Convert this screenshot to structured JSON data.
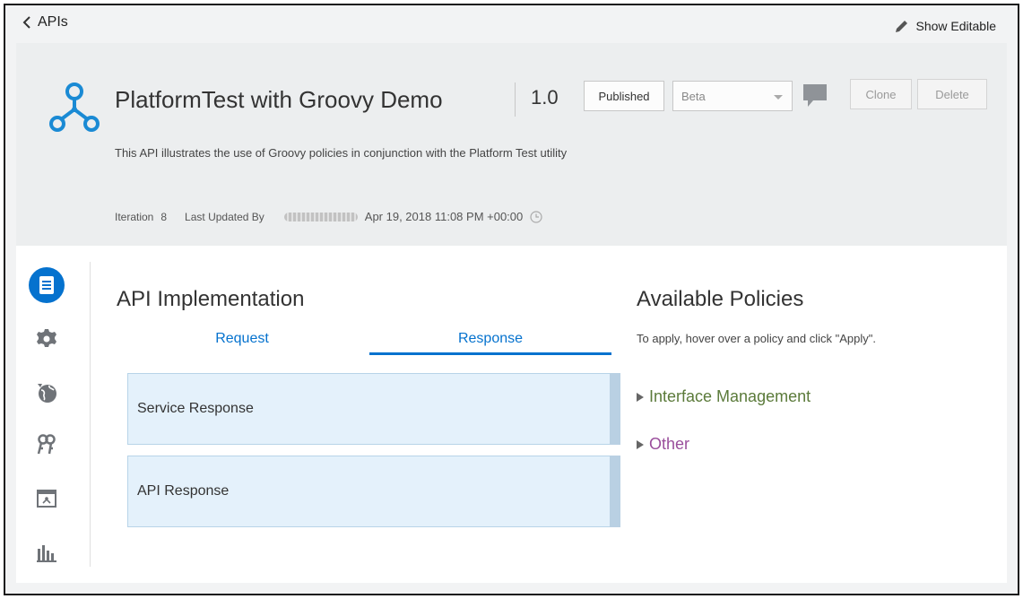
{
  "topbar": {
    "back_label": "APIs",
    "show_editable_label": "Show Editable"
  },
  "header": {
    "title": "PlatformTest with Groovy Demo",
    "version": "1.0",
    "state_button": "Published",
    "stage_select": {
      "selected": "Beta"
    },
    "clone_label": "Clone",
    "delete_label": "Delete",
    "description": "This API illustrates the use of Groovy policies in conjunction with the Platform Test utility",
    "meta": {
      "iteration_label": "Iteration",
      "iteration_value": "8",
      "updated_by_label": "Last Updated By",
      "updated_date": "Apr 19, 2018 11:08 PM +00:00"
    }
  },
  "sidebar": {
    "items": [
      {
        "icon": "implementation-icon",
        "active": true
      },
      {
        "icon": "gear-icon"
      },
      {
        "icon": "globe-icon"
      },
      {
        "icon": "keys-icon"
      },
      {
        "icon": "deployment-icon"
      },
      {
        "icon": "analytics-icon"
      }
    ]
  },
  "implementation": {
    "title": "API Implementation",
    "tabs": [
      {
        "label": "Request",
        "active": false
      },
      {
        "label": "Response",
        "active": true
      }
    ],
    "flow": [
      {
        "label": "Service Response"
      },
      {
        "label": "API Response"
      }
    ]
  },
  "policies": {
    "title": "Available Policies",
    "hint": "To apply, hover over a policy and click \"Apply\".",
    "groups": [
      {
        "label": "Interface Management",
        "color": "#5b7a3a"
      },
      {
        "label": "Other",
        "color": "#9a4e9c"
      }
    ]
  },
  "colors": {
    "accent": "#0572ce",
    "flow_bg": "#e4f1fb",
    "header_bg": "#eceeef"
  }
}
